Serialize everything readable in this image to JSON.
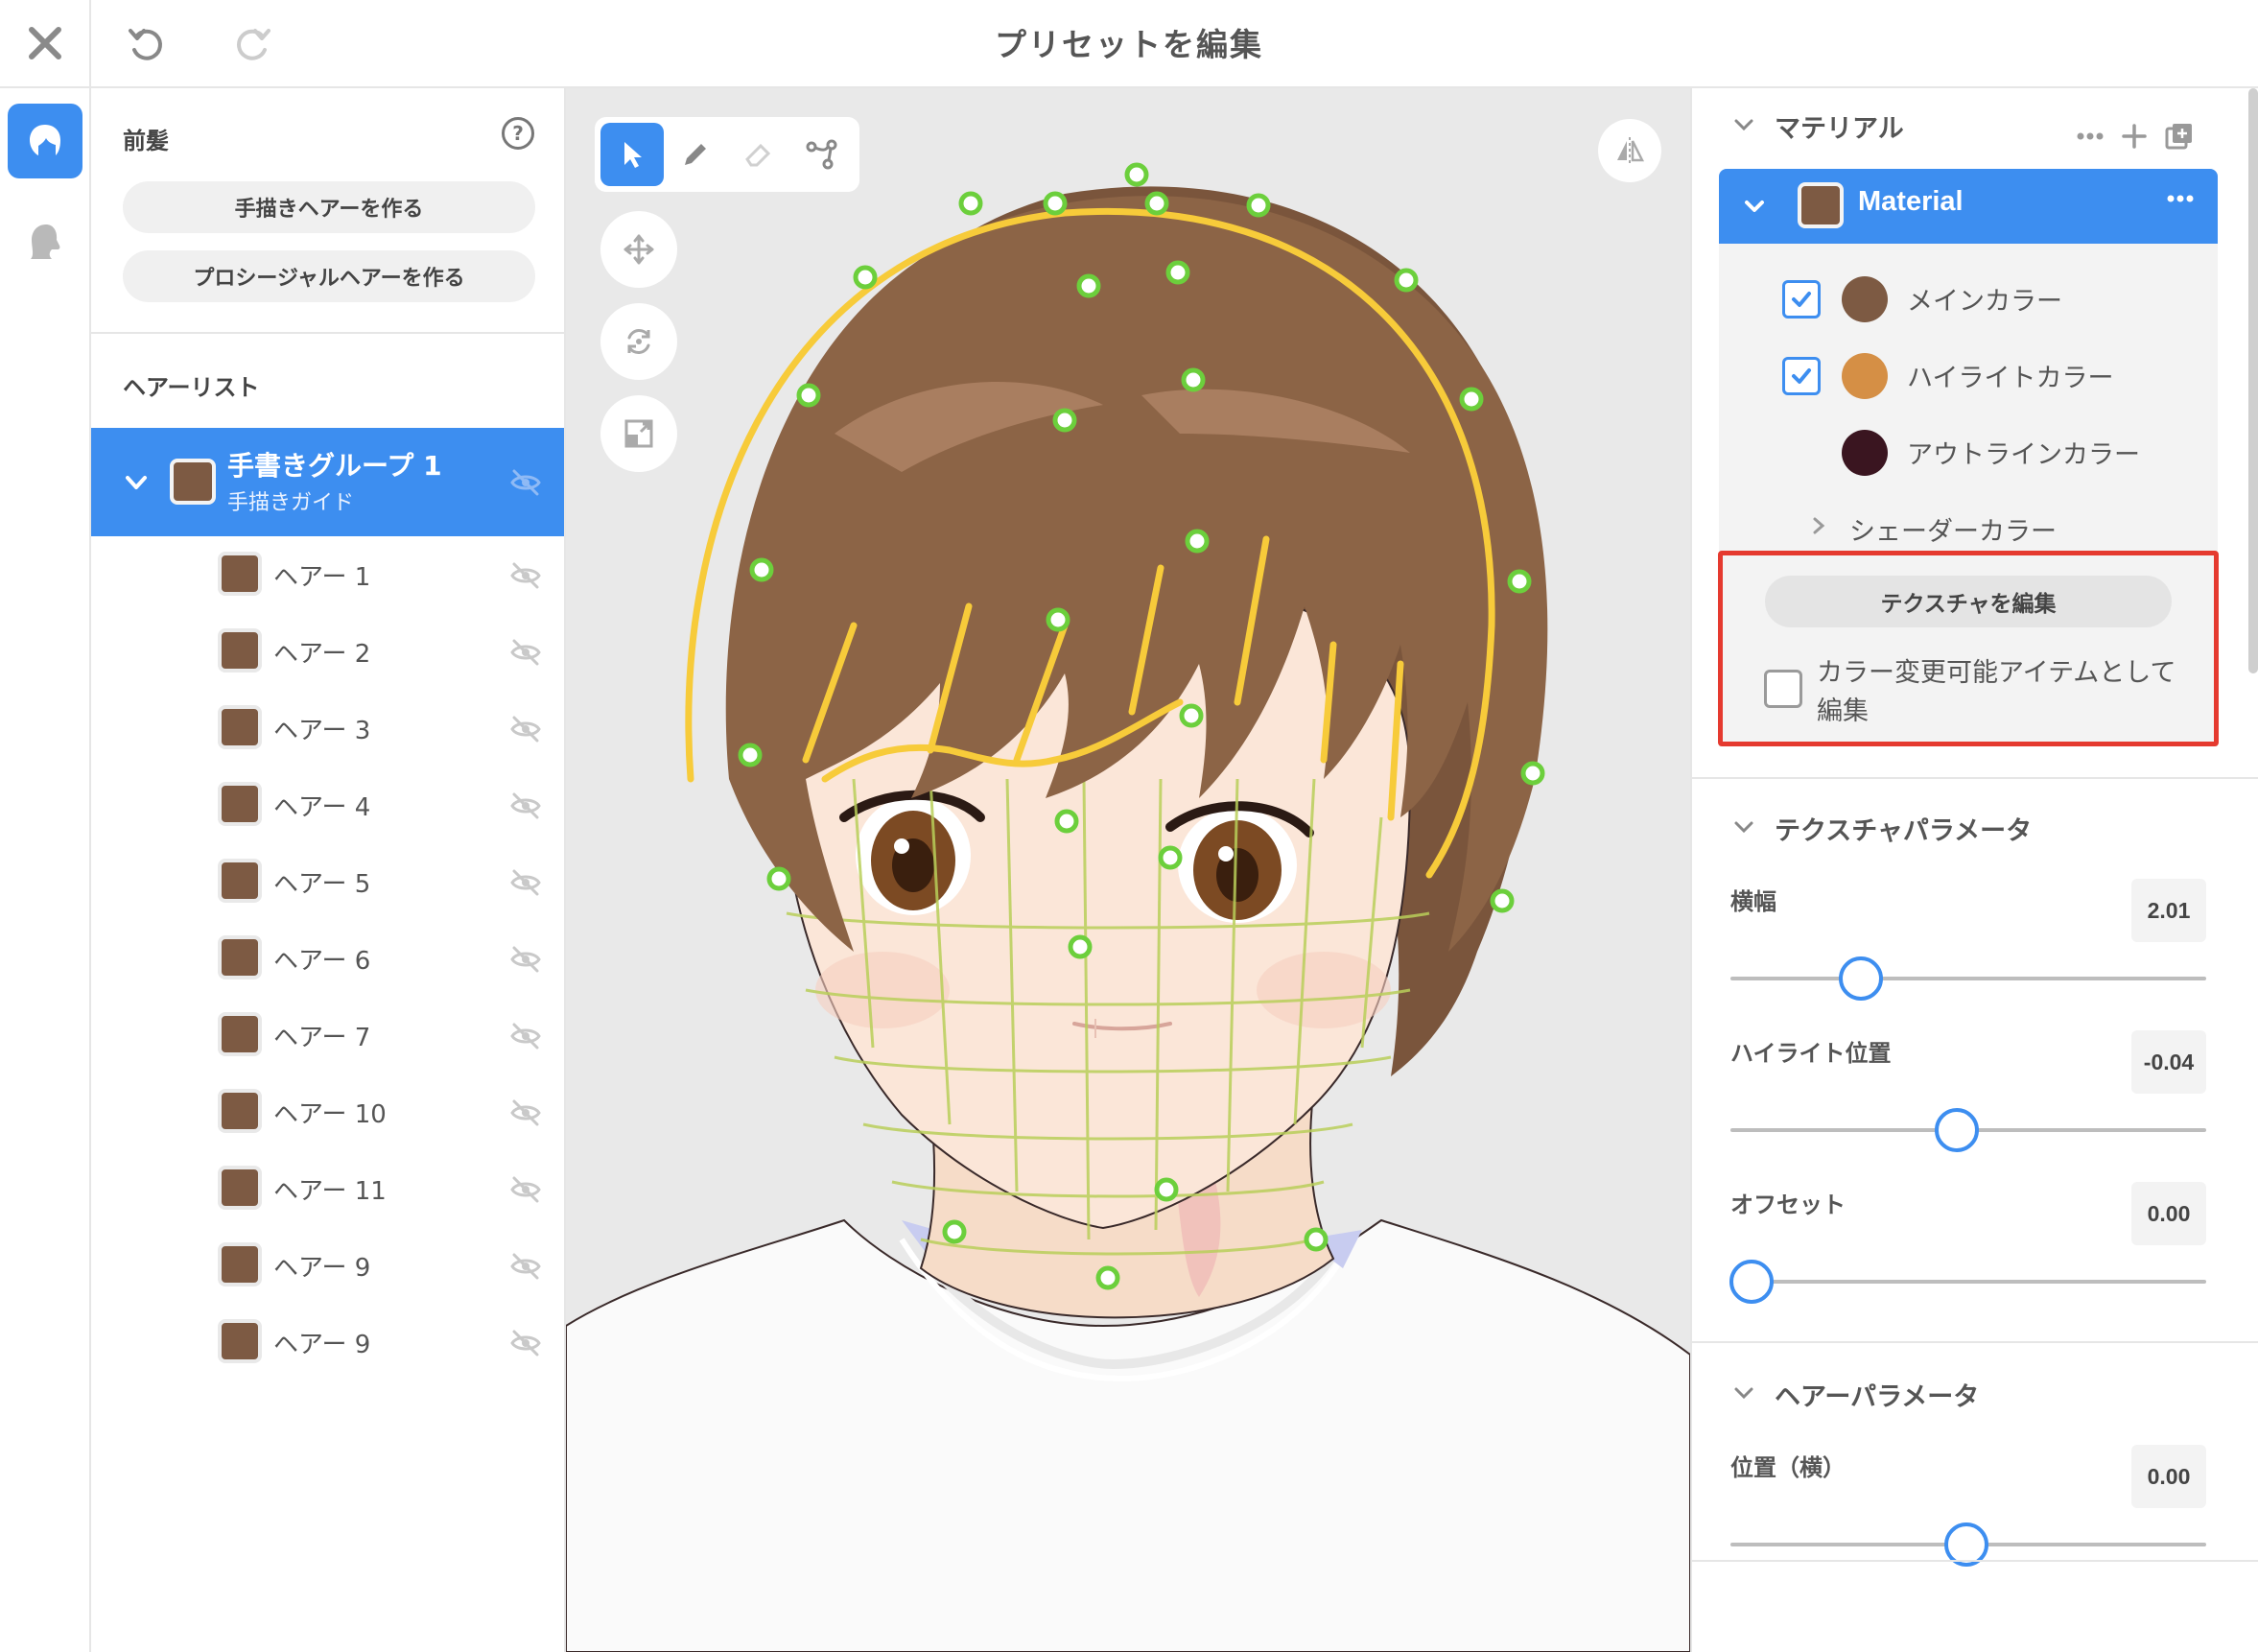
{
  "window": {
    "title": "プリセットを編集"
  },
  "left_panel": {
    "section_title": "前髪",
    "help_label": "?",
    "buttons": [
      "手描きヘアーを作る",
      "プロシージャルヘアーを作る"
    ],
    "list_header": "ヘアーリスト",
    "group": {
      "name": "手書きグループ 1",
      "subtitle": "手描きガイド",
      "color": "#7d5a43"
    },
    "items": [
      {
        "label": "ヘアー 1"
      },
      {
        "label": "ヘアー 2"
      },
      {
        "label": "ヘアー 3"
      },
      {
        "label": "ヘアー 4"
      },
      {
        "label": "ヘアー 5"
      },
      {
        "label": "ヘアー 6"
      },
      {
        "label": "ヘアー 7"
      },
      {
        "label": "ヘアー 10"
      },
      {
        "label": "ヘアー 11"
      },
      {
        "label": "ヘアー 9"
      },
      {
        "label": "ヘアー 9"
      }
    ]
  },
  "viewport": {
    "tools": [
      "select-tool",
      "pen-tool",
      "eraser-tool",
      "node-tool"
    ],
    "active_tool": "select-tool",
    "side_buttons": [
      "move-icon",
      "rotate-icon",
      "scale-icon"
    ],
    "mirror_button": "mirror-icon"
  },
  "right_panel": {
    "material_section": {
      "title": "マテリアル",
      "material_name": "Material",
      "material_color": "#7d5a43",
      "colors": [
        {
          "label": "メインカラー",
          "checked": true,
          "color": "#7d5a43"
        },
        {
          "label": "ハイライトカラー",
          "checked": true,
          "color": "#d58f45"
        },
        {
          "label": "アウトラインカラー",
          "checked": false,
          "color": "#3a1520"
        }
      ],
      "shader_label": "シェーダーカラー",
      "edit_texture_button": "テクスチャを編集",
      "color_variable_label": "カラー変更可能アイテムとして編集",
      "color_variable_checked": false
    },
    "texture_params": {
      "title": "テクスチャパラメータ",
      "params": [
        {
          "label": "横幅",
          "value": "2.01",
          "fraction": 0.275
        },
        {
          "label": "ハイライト位置",
          "value": "-0.04",
          "fraction": 0.475
        },
        {
          "label": "オフセット",
          "value": "0.00",
          "fraction": 0.045
        }
      ]
    },
    "hair_params": {
      "title": "ヘアーパラメータ",
      "params": [
        {
          "label": "位置（横）",
          "value": "0.00",
          "fraction": 0.495
        }
      ]
    }
  }
}
